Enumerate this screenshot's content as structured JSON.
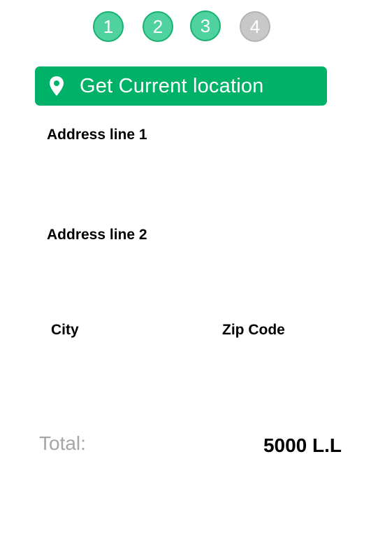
{
  "stepper": {
    "steps": [
      {
        "label": "1",
        "state": "completed"
      },
      {
        "label": "2",
        "state": "completed"
      },
      {
        "label": "3",
        "state": "current"
      },
      {
        "label": "4",
        "state": "pending"
      }
    ],
    "colors": {
      "completed_fill": "#4fd1a0",
      "completed_border": "#18b26f",
      "pending_fill": "#c8c8c8"
    }
  },
  "location_button": {
    "label": "Get Current location",
    "icon": "map-pin-icon",
    "color": "#00b268"
  },
  "form": {
    "address_line_1": {
      "label": "Address line 1",
      "value": ""
    },
    "address_line_2": {
      "label": "Address line 2",
      "value": ""
    },
    "city": {
      "label": "City",
      "value": ""
    },
    "zip_code": {
      "label": "Zip Code",
      "value": ""
    }
  },
  "total": {
    "label": "Total:",
    "value": "5000 L.L"
  }
}
